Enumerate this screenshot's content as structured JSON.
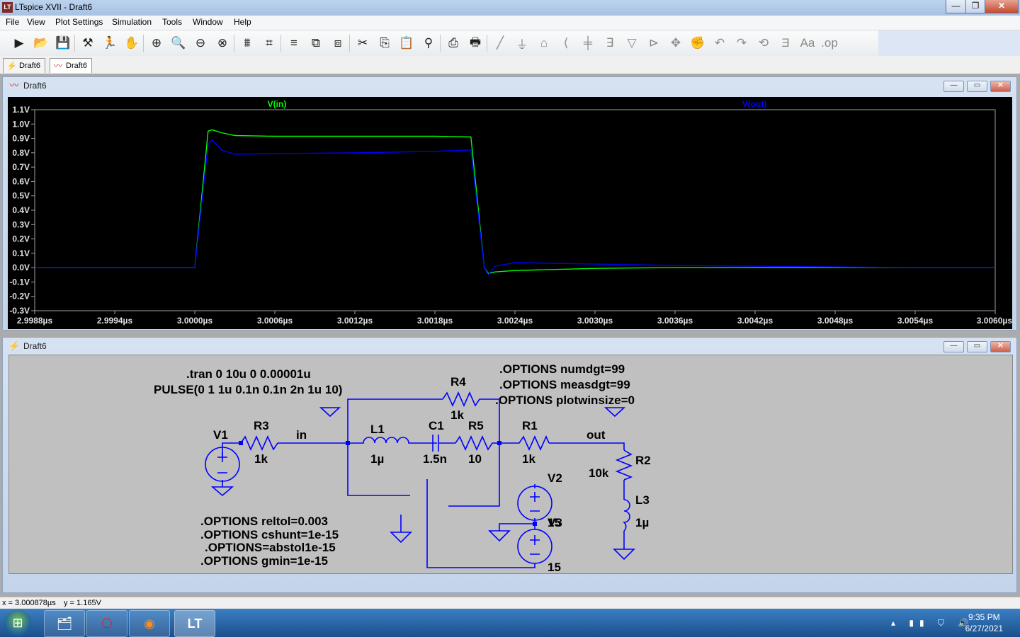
{
  "app": {
    "title": "LTspice XVII - Draft6",
    "logo": "LT",
    "controls": {
      "minimize": "—",
      "maximize": "❐",
      "close": "✕"
    }
  },
  "menu": [
    "File",
    "View",
    "Plot Settings",
    "Simulation",
    "Tools",
    "Window",
    "Help"
  ],
  "toolbar": {
    "icons": [
      "run-icon",
      "open-icon",
      "save-icon",
      "control-panel-icon",
      "run-man-icon",
      "pan-hand-icon",
      "zoom-in-icon",
      "zoom-area-icon",
      "zoom-out-icon",
      "zoom-fit-icon",
      "autorange-icon",
      "edit-waveform-icon",
      "tile-horizontal-icon",
      "cascade-icon",
      "tile-vertical-icon",
      "cut-icon",
      "copy-icon",
      "paste-icon",
      "find-icon",
      "print-icon",
      "print-setup-icon",
      "wire-icon",
      "ground-icon",
      "label-icon",
      "resistor-icon",
      "capacitor-icon",
      "inductor-icon",
      "diode-icon",
      "component-icon",
      "move-icon",
      "drag-icon",
      "undo-icon",
      "redo-icon",
      "rotate-icon",
      "mirror-icon",
      "text-icon",
      "spice-directive-icon"
    ],
    "glyphs": [
      "▶",
      "📂",
      "💾",
      "⚒",
      "🏃",
      "✋",
      "⊕",
      "🔍",
      "⊖",
      "⊗",
      "⩩",
      "⌗",
      "≡",
      "⧉",
      "⧈",
      "✂",
      "⎘",
      "📋",
      "⚲",
      "⎙",
      "🖶",
      "╱",
      "⏚",
      "⌂",
      "⟨",
      "╪",
      "∃",
      "▽",
      "⊳",
      "✥",
      "✊",
      "↶",
      "↷",
      "⟲",
      "Ǝ",
      "Aa",
      ".op"
    ]
  },
  "tabs": [
    {
      "label": "Draft6",
      "icon": "schematic-icon",
      "glyph": "⚡"
    },
    {
      "label": "Draft6",
      "icon": "waveform-icon",
      "glyph": "〰"
    }
  ],
  "plot_window": {
    "title": "Draft6",
    "icon_glyph": "〰",
    "controls": [
      "—",
      "▭",
      "✕"
    ]
  },
  "schematic_window": {
    "title": "Draft6",
    "icon_glyph": "⚡",
    "controls": [
      "—",
      "▭",
      "✕"
    ]
  },
  "chart_data": {
    "type": "line",
    "title": "",
    "xlim": [
      2.9988,
      3.006
    ],
    "ylim": [
      -0.3,
      1.1
    ],
    "x_unit": "µs",
    "xticks": [
      "2.9988µs",
      "2.9994µs",
      "3.0000µs",
      "3.0006µs",
      "3.0012µs",
      "3.0018µs",
      "3.0024µs",
      "3.0030µs",
      "3.0036µs",
      "3.0042µs",
      "3.0048µs",
      "3.0054µs",
      "3.0060µs"
    ],
    "yticks": [
      "1.1V",
      "1.0V",
      "0.9V",
      "0.8V",
      "0.7V",
      "0.6V",
      "0.5V",
      "0.4V",
      "0.3V",
      "0.2V",
      "0.1V",
      "0.0V",
      "-0.1V",
      "-0.2V",
      "-0.3V"
    ],
    "grid": false,
    "series": [
      {
        "name": "V(in)",
        "color": "#00ff00",
        "x": [
          2.9988,
          3.0,
          3.0001,
          3.00013,
          3.0002,
          3.0003,
          3.0006,
          3.0012,
          3.0018,
          3.00207,
          3.00217,
          3.0022,
          3.00225,
          3.0024,
          3.003,
          3.0036,
          3.0042,
          3.0048,
          3.0054,
          3.006
        ],
        "y": [
          0.0,
          0.0,
          0.95,
          0.96,
          0.94,
          0.92,
          0.915,
          0.915,
          0.915,
          0.91,
          0.0,
          -0.04,
          -0.03,
          -0.02,
          -0.005,
          0.0,
          0.0,
          0.0,
          0.0,
          0.0
        ]
      },
      {
        "name": "V(out)",
        "color": "#0000ff",
        "x": [
          2.9988,
          3.0,
          3.0001,
          3.00013,
          3.0002,
          3.0003,
          3.0006,
          3.0012,
          3.0018,
          3.00207,
          3.00217,
          3.0022,
          3.00225,
          3.0024,
          3.003,
          3.0036,
          3.0042,
          3.0048,
          3.0054,
          3.006
        ],
        "y": [
          0.0,
          0.0,
          0.86,
          0.89,
          0.82,
          0.79,
          0.795,
          0.8,
          0.81,
          0.82,
          0.0,
          -0.05,
          0.01,
          0.035,
          0.025,
          0.015,
          0.01,
          0.005,
          0.0,
          0.0
        ]
      }
    ]
  },
  "schematic": {
    "directives_tran": [
      ".tran 0 10u 0 0.00001u",
      "PULSE(0 1 1u 0.1n 0.1n 2n 1u 10)"
    ],
    "directives_options_top": [
      ".OPTIONS numdgt=99",
      ".OPTIONS measdgt=99",
      ".OPTIONS plotwinsize=0"
    ],
    "directives_options_bottom": [
      ".OPTIONS reltol=0.003",
      ".OPTIONS cshunt=1e-15",
      ".OPTIONS=abstol1e-15",
      ".OPTIONS gmin=1e-15"
    ],
    "labels": {
      "v1": "V1",
      "r3": "R3",
      "r3_val": "1k",
      "net_in": "in",
      "l1": "L1",
      "l1_val": "1µ",
      "c1": "C1",
      "c1_val": "1.5n",
      "r5": "R5",
      "r5_val": "10",
      "r4": "R4",
      "r4_val": "1k",
      "r1": "R1",
      "r1_val": "1k",
      "net_out": "out",
      "r2": "R2",
      "r2_val": "10k",
      "l3": "L3",
      "l3_val": "1µ",
      "v2": "V2",
      "v3_overlap": "V3",
      "v3_val": "15"
    }
  },
  "status": {
    "x_readout": "x = 3.000878µs",
    "y_readout": "y = 1.165V"
  },
  "taskbar": {
    "start_glyph": "⊞",
    "apps": [
      {
        "name": "explorer-icon",
        "glyph": "🗂"
      },
      {
        "name": "acrobat-icon",
        "glyph": "⎔"
      },
      {
        "name": "firefox-icon",
        "glyph": "◉"
      },
      {
        "name": "ltspice-icon",
        "glyph": "LT"
      }
    ],
    "tray": "▴ ▮▮ ⛉ 🔊",
    "time": "9:35 PM",
    "date": "6/27/2021"
  }
}
